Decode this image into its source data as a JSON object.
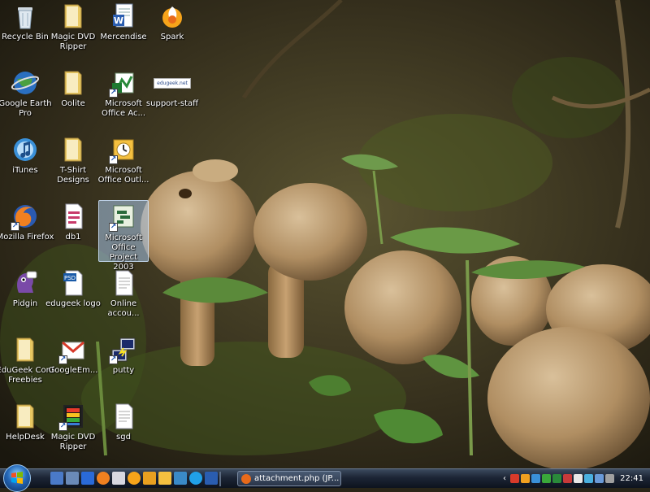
{
  "desktop": {
    "icons": [
      {
        "label": "Recycle Bin",
        "icon": "recycle-bin-icon"
      },
      {
        "label": "Magic DVD Ripper",
        "icon": "folder-icon"
      },
      {
        "label": "Mercendise",
        "icon": "word-document-icon"
      },
      {
        "label": "Spark",
        "icon": "spark-icon"
      },
      {
        "label": "Google Earth Pro",
        "icon": "google-earth-icon"
      },
      {
        "label": "Oolite",
        "icon": "folder-icon"
      },
      {
        "label": "Microsoft Office Ac...",
        "icon": "access-icon"
      },
      {
        "label": "support-staff",
        "icon": "web-link-icon"
      },
      {
        "label": "iTunes",
        "icon": "itunes-icon"
      },
      {
        "label": "T-Shirt Designs",
        "icon": "folder-icon"
      },
      {
        "label": "Microsoft Office Outl...",
        "icon": "outlook-icon"
      },
      {
        "label": "Mozilla Firefox",
        "icon": "firefox-icon"
      },
      {
        "label": "db1",
        "icon": "document-icon"
      },
      {
        "label": "Microsoft Office Project 2003",
        "icon": "project-icon"
      },
      {
        "label": "Pidgin",
        "icon": "pidgin-icon"
      },
      {
        "label": "edugeek logo",
        "icon": "psd-icon"
      },
      {
        "label": "Online accou...",
        "icon": "text-file-icon"
      },
      {
        "label": "EduGeek Conf Freebies",
        "icon": "folder-icon"
      },
      {
        "label": "GoogleEm...",
        "icon": "gmail-icon"
      },
      {
        "label": "putty",
        "icon": "putty-icon"
      },
      {
        "label": "HelpDesk",
        "icon": "folder-icon"
      },
      {
        "label": "Magic DVD Ripper",
        "icon": "dvd-ripper-icon"
      },
      {
        "label": "sgd",
        "icon": "text-file-icon"
      }
    ],
    "selected": "Microsoft Office Project 2003",
    "support_staff_logo": "edugeek.net"
  },
  "taskbar": {
    "quick_launch": [
      "show-desktop-icon",
      "switch-windows-icon",
      "ie-icon",
      "firefox-icon",
      "mail-icon",
      "spark-icon",
      "media-icon",
      "outlook-icon",
      "app-icon",
      "skype-icon",
      "word-icon"
    ],
    "task_button": "attachment.php (JP...",
    "tray_arrow": "‹",
    "clock": "22:41"
  },
  "colors": {
    "folder": "#e8c862",
    "accent_orb": "#2467b8"
  }
}
